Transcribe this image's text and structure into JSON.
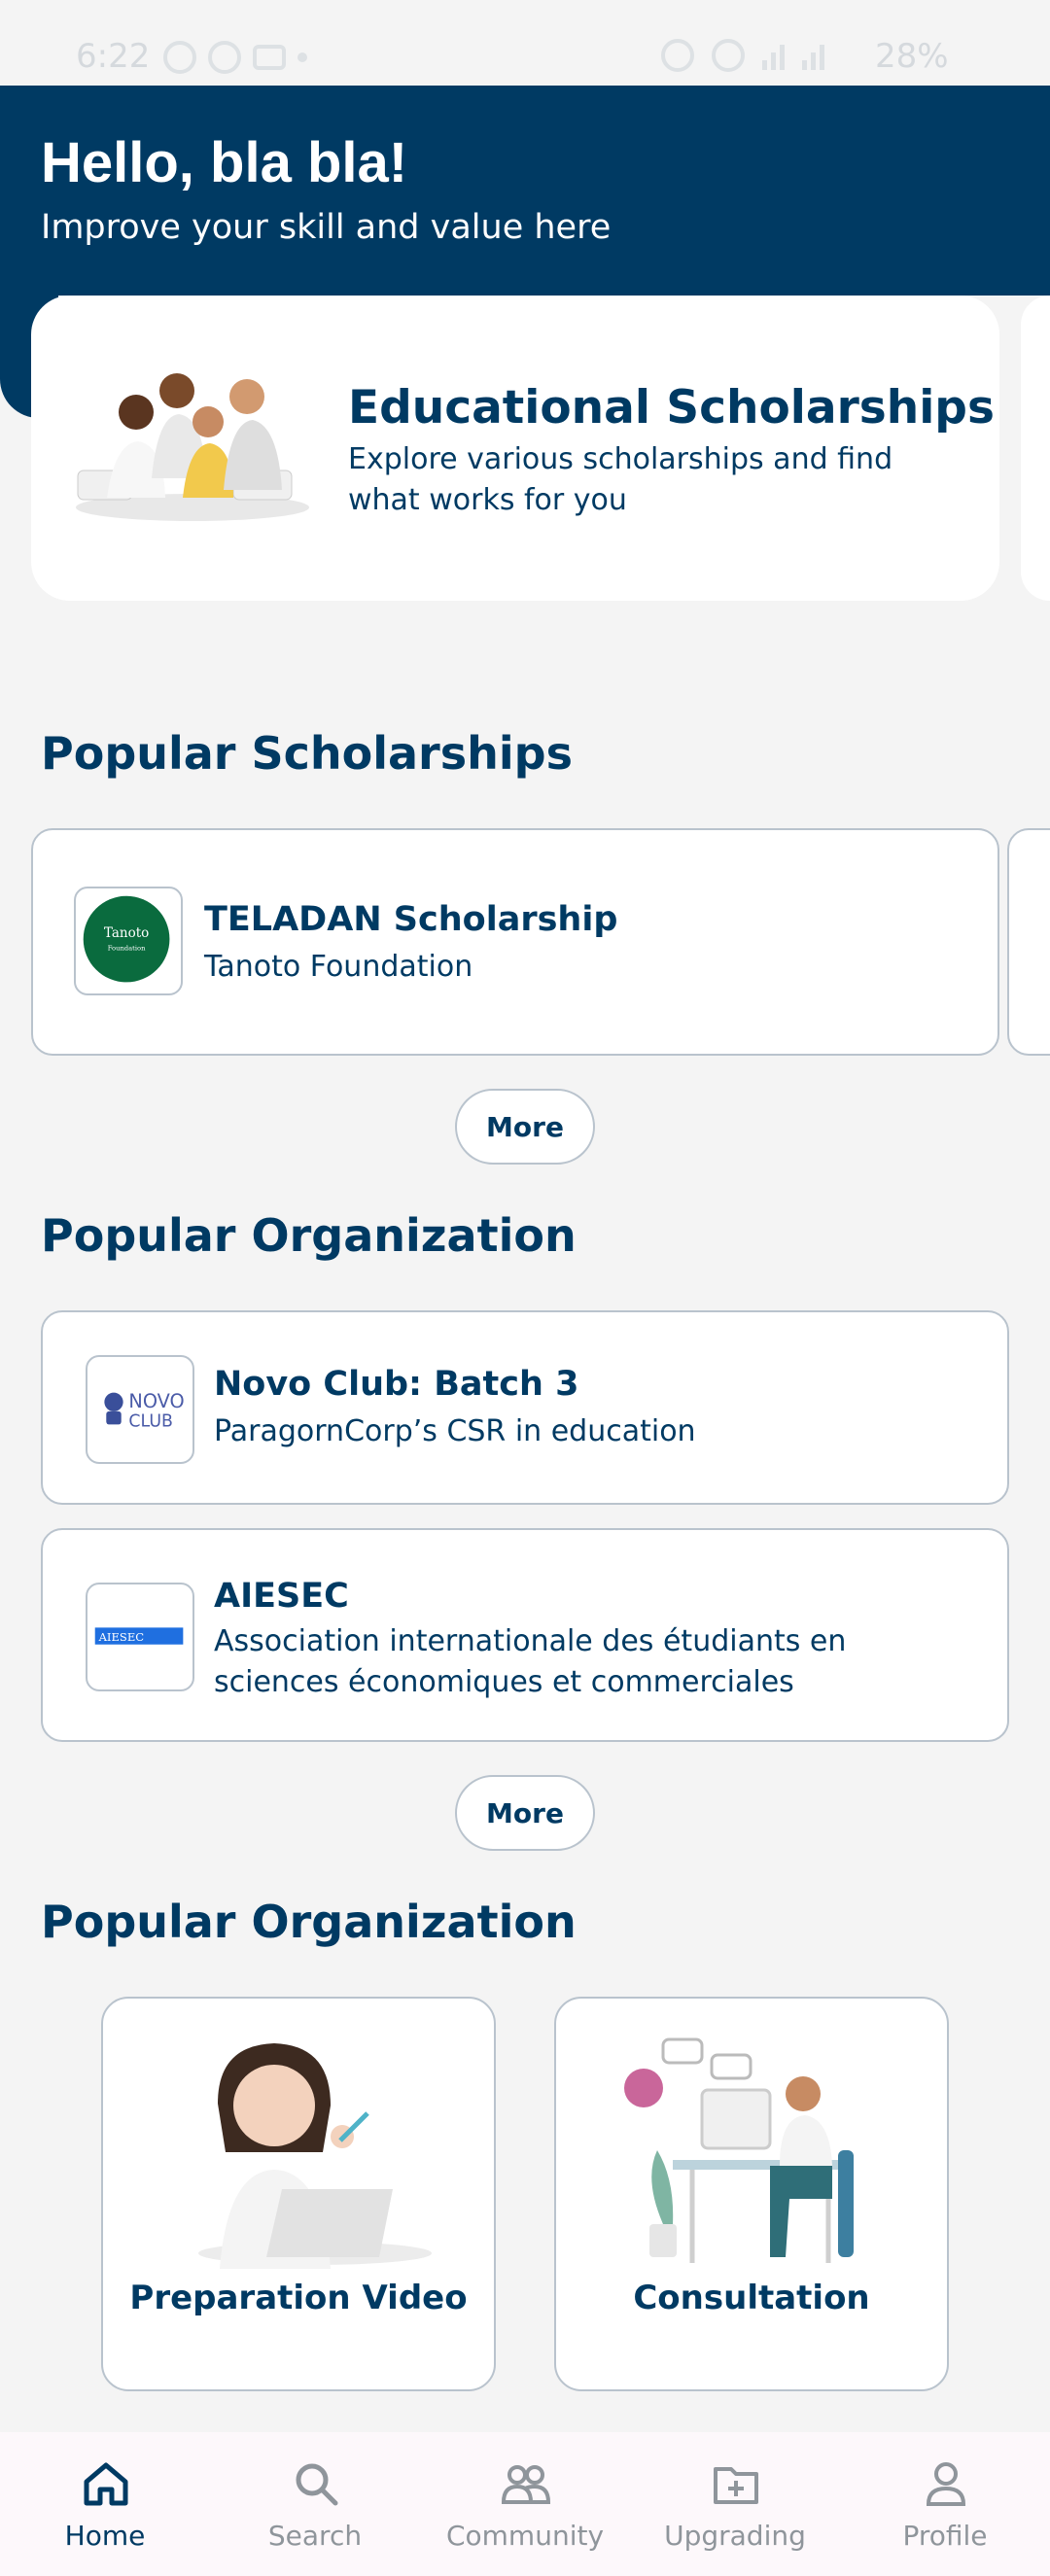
{
  "status_bar": {
    "time": "6:22",
    "battery": "28%"
  },
  "header": {
    "greeting": "Hello, bla bla!",
    "subtitle": "Improve your skill and value here"
  },
  "feature_card": {
    "title": "Educational Scholarships",
    "description": "Explore various scholarships and find what works for you"
  },
  "scholarships": {
    "section_title": "Popular Scholarships",
    "items": [
      {
        "name": "TELADAN Scholarship",
        "org": "Tanoto Foundation",
        "logo_text": "Tanoto Foundation"
      }
    ],
    "more_label": "More"
  },
  "organizations": {
    "section_title": "Popular Organization",
    "items": [
      {
        "name": "Novo Club: Batch 3",
        "desc": "ParagornCorp’s CSR in education",
        "logo_text": "NOVO CLUB"
      },
      {
        "name": "AIESEC",
        "desc": "Association internationale des étudiants en sciences économiques et commerciales",
        "logo_text": "AIESEC"
      }
    ],
    "more_label": "More"
  },
  "services": {
    "section_title": "Popular Organization",
    "tiles": [
      {
        "label": "Preparation Video"
      },
      {
        "label": "Consultation"
      }
    ]
  },
  "bottom_nav": {
    "items": [
      {
        "label": "Home",
        "icon": "home-icon",
        "active": true
      },
      {
        "label": "Search",
        "icon": "search-icon",
        "active": false
      },
      {
        "label": "Community",
        "icon": "community-icon",
        "active": false
      },
      {
        "label": "Upgrading",
        "icon": "folder-plus-icon",
        "active": false
      },
      {
        "label": "Profile",
        "icon": "profile-icon",
        "active": false
      }
    ]
  },
  "colors": {
    "primary": "#003a63",
    "background": "#f4f4f4",
    "border": "#b9c3cd",
    "inactive": "#8f959b"
  }
}
